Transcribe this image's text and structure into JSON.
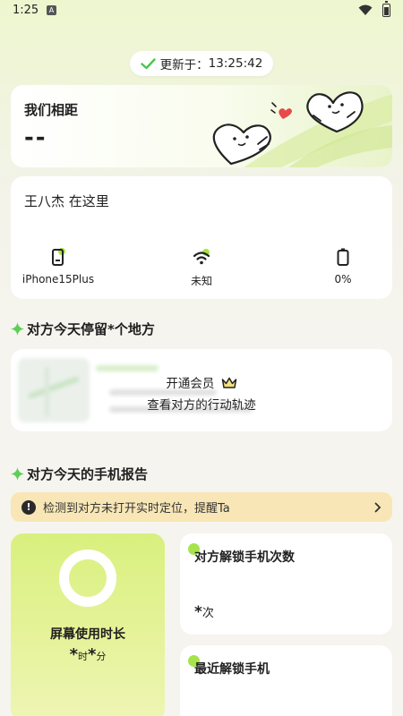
{
  "status_bar": {
    "time": "1:25"
  },
  "updated": {
    "label": "更新于：",
    "time": "13:25:42"
  },
  "distance": {
    "title": "我们相距",
    "value": "--"
  },
  "device": {
    "title": "王八杰 在这里",
    "items": [
      {
        "label": "iPhone15Plus",
        "icon": "phone-icon"
      },
      {
        "label": "未知",
        "icon": "wifi-icon"
      },
      {
        "label": "0%",
        "icon": "battery-icon"
      }
    ]
  },
  "places": {
    "title": "对方今天停留*个地方",
    "overlay_line1": "开通会员",
    "overlay_line2": "查看对方的行动轨迹"
  },
  "report": {
    "title": "对方今天的手机报告",
    "alert_text": "检测到对方未打开实时定位，提醒Ta",
    "screen_time": {
      "label": "屏幕使用时长",
      "hours": "*",
      "hour_unit": "时",
      "minutes": "*",
      "minute_unit": "分"
    },
    "unlock_count": {
      "title": "对方解锁手机次数",
      "value": "*",
      "unit": "次"
    },
    "recent_unlock": {
      "title": "最近解锁手机"
    }
  },
  "colors": {
    "accent_green": "#a6e44a",
    "alert_bg": "#f8e6b6"
  }
}
